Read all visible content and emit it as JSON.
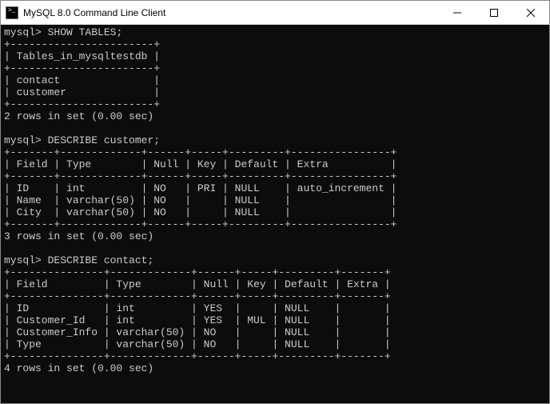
{
  "window": {
    "title": "MySQL 8.0 Command Line Client"
  },
  "prompt": "mysql>",
  "block1": {
    "cmd": "SHOW TABLES;",
    "sep": "+-----------------------+",
    "header": "| Tables_in_mysqltestdb |",
    "row1": "| contact               |",
    "row2": "| customer              |",
    "status": "2 rows in set (0.00 sec)"
  },
  "block2": {
    "cmd": "DESCRIBE customer;",
    "sep": "+-------+-------------+------+-----+---------+----------------+",
    "header": "| Field | Type        | Null | Key | Default | Extra          |",
    "row1": "| ID    | int         | NO   | PRI | NULL    | auto_increment |",
    "row2": "| Name  | varchar(50) | NO   |     | NULL    |                |",
    "row3": "| City  | varchar(50) | NO   |     | NULL    |                |",
    "status": "3 rows in set (0.00 sec)"
  },
  "block3": {
    "cmd": "DESCRIBE contact;",
    "sep": "+---------------+-------------+------+-----+---------+-------+",
    "header": "| Field         | Type        | Null | Key | Default | Extra |",
    "row1": "| ID            | int         | YES  |     | NULL    |       |",
    "row2": "| Customer_Id   | int         | YES  | MUL | NULL    |       |",
    "row3": "| Customer_Info | varchar(50) | NO   |     | NULL    |       |",
    "row4": "| Type          | varchar(50) | NO   |     | NULL    |       |",
    "status": "4 rows in set (0.00 sec)"
  },
  "chart_data": {
    "type": "table",
    "tables_list": [
      "contact",
      "customer"
    ],
    "describe_customer": {
      "columns": [
        "Field",
        "Type",
        "Null",
        "Key",
        "Default",
        "Extra"
      ],
      "rows": [
        [
          "ID",
          "int",
          "NO",
          "PRI",
          "NULL",
          "auto_increment"
        ],
        [
          "Name",
          "varchar(50)",
          "NO",
          "",
          "NULL",
          ""
        ],
        [
          "City",
          "varchar(50)",
          "NO",
          "",
          "NULL",
          ""
        ]
      ]
    },
    "describe_contact": {
      "columns": [
        "Field",
        "Type",
        "Null",
        "Key",
        "Default",
        "Extra"
      ],
      "rows": [
        [
          "ID",
          "int",
          "YES",
          "",
          "NULL",
          ""
        ],
        [
          "Customer_Id",
          "int",
          "YES",
          "MUL",
          "NULL",
          ""
        ],
        [
          "Customer_Info",
          "varchar(50)",
          "NO",
          "",
          "NULL",
          ""
        ],
        [
          "Type",
          "varchar(50)",
          "NO",
          "",
          "NULL",
          ""
        ]
      ]
    }
  }
}
